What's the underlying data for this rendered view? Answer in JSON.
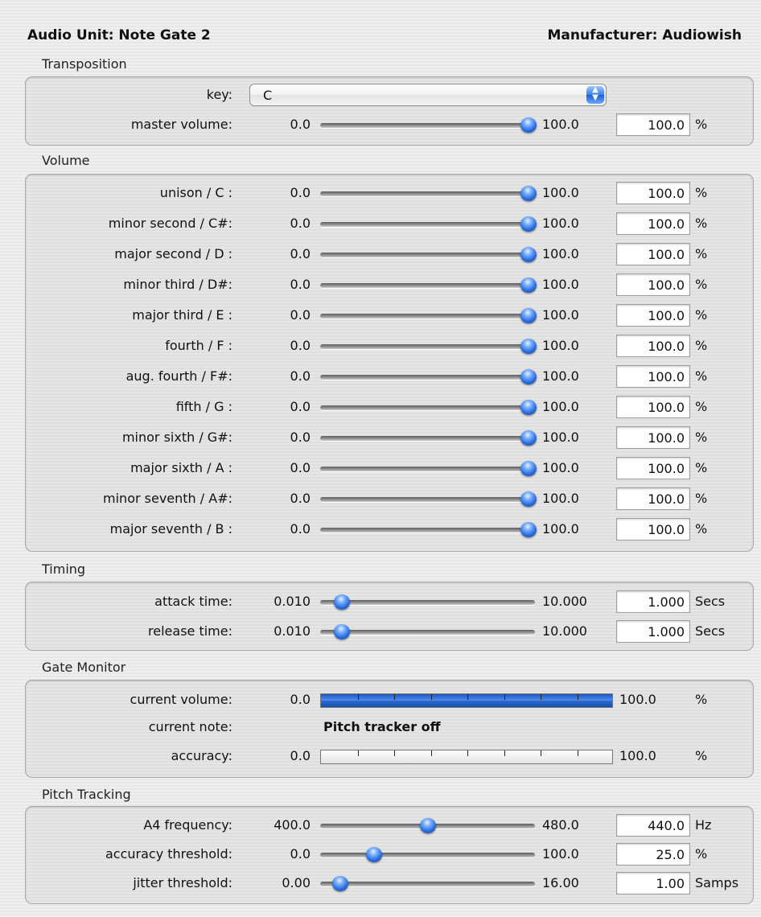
{
  "header": {
    "audio_unit": "Audio Unit: Note Gate 2",
    "manufacturer": "Manufacturer: Audiowish"
  },
  "transposition": {
    "title": "Transposition",
    "key_label": "key:",
    "key_value": "C",
    "master": {
      "label": "master volume:",
      "min": "0.0",
      "max": "100.0",
      "value": "100.0",
      "unit": "%",
      "fraction": 1.0
    }
  },
  "volume": {
    "title": "Volume",
    "rows": [
      {
        "label": "unison / C  :",
        "min": "0.0",
        "max": "100.0",
        "value": "100.0",
        "unit": "%",
        "fraction": 1.0
      },
      {
        "label": "minor second / C#:",
        "min": "0.0",
        "max": "100.0",
        "value": "100.0",
        "unit": "%",
        "fraction": 1.0
      },
      {
        "label": "major second / D  :",
        "min": "0.0",
        "max": "100.0",
        "value": "100.0",
        "unit": "%",
        "fraction": 1.0
      },
      {
        "label": "minor third / D#:",
        "min": "0.0",
        "max": "100.0",
        "value": "100.0",
        "unit": "%",
        "fraction": 1.0
      },
      {
        "label": "major third / E  :",
        "min": "0.0",
        "max": "100.0",
        "value": "100.0",
        "unit": "%",
        "fraction": 1.0
      },
      {
        "label": "fourth / F  :",
        "min": "0.0",
        "max": "100.0",
        "value": "100.0",
        "unit": "%",
        "fraction": 1.0
      },
      {
        "label": "aug. fourth / F#:",
        "min": "0.0",
        "max": "100.0",
        "value": "100.0",
        "unit": "%",
        "fraction": 1.0
      },
      {
        "label": "fifth / G  :",
        "min": "0.0",
        "max": "100.0",
        "value": "100.0",
        "unit": "%",
        "fraction": 1.0
      },
      {
        "label": "minor sixth / G#:",
        "min": "0.0",
        "max": "100.0",
        "value": "100.0",
        "unit": "%",
        "fraction": 1.0
      },
      {
        "label": "major sixth / A  :",
        "min": "0.0",
        "max": "100.0",
        "value": "100.0",
        "unit": "%",
        "fraction": 1.0
      },
      {
        "label": "minor seventh / A#:",
        "min": "0.0",
        "max": "100.0",
        "value": "100.0",
        "unit": "%",
        "fraction": 1.0
      },
      {
        "label": "major seventh / B  :",
        "min": "0.0",
        "max": "100.0",
        "value": "100.0",
        "unit": "%",
        "fraction": 1.0
      }
    ]
  },
  "timing": {
    "title": "Timing",
    "rows": [
      {
        "label": "attack time:",
        "min": "0.010",
        "max": "10.000",
        "value": "1.000",
        "unit": "Secs",
        "fraction": 0.1
      },
      {
        "label": "release time:",
        "min": "0.010",
        "max": "10.000",
        "value": "1.000",
        "unit": "Secs",
        "fraction": 0.1
      }
    ]
  },
  "gate_monitor": {
    "title": "Gate Monitor",
    "current_volume": {
      "label": "current volume:",
      "min": "0.0",
      "max": "100.0",
      "unit": "%",
      "fraction": 1.0
    },
    "current_note": {
      "label": "current note:",
      "value": "Pitch tracker off"
    },
    "accuracy": {
      "label": "accuracy:",
      "min": "0.0",
      "max": "100.0",
      "unit": "%",
      "fraction": 0.0
    }
  },
  "pitch_tracking": {
    "title": "Pitch Tracking",
    "rows": [
      {
        "label": "A4 frequency:",
        "min": "400.0",
        "max": "480.0",
        "value": "440.0",
        "unit": "Hz",
        "fraction": 0.5
      },
      {
        "label": "accuracy threshold:",
        "min": "0.0",
        "max": "100.0",
        "value": "25.0",
        "unit": "%",
        "fraction": 0.25
      },
      {
        "label": "jitter threshold:",
        "min": "0.00",
        "max": "16.00",
        "value": "1.00",
        "unit": "Samps",
        "fraction": 0.0625
      }
    ]
  },
  "colors": {
    "knob": "#2c6fde",
    "meter": "#2a6ad5"
  }
}
